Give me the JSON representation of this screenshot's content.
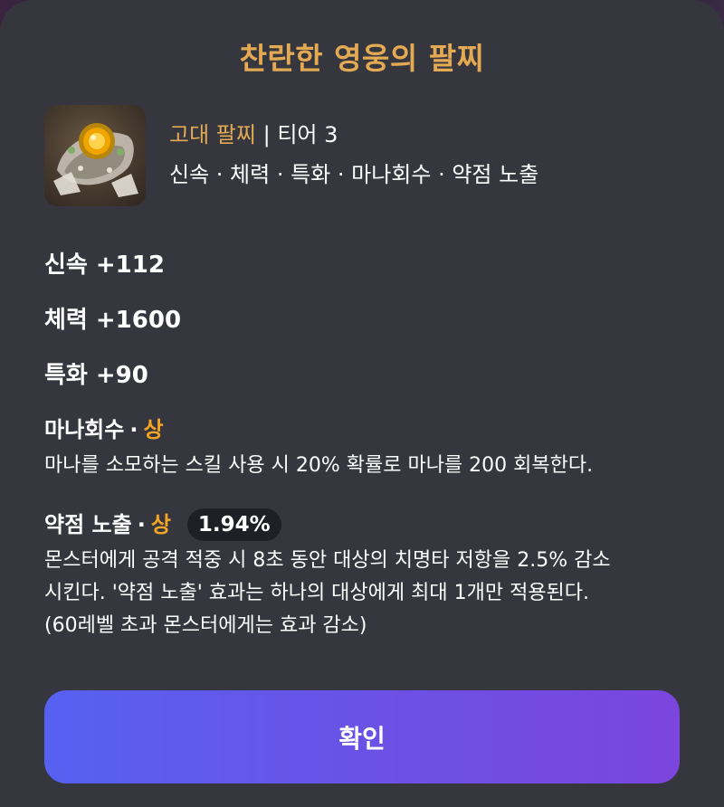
{
  "title": "찬란한 영웅의 팔찌",
  "item": {
    "icon": "bracelet-item-icon",
    "grade": "고대 팔찌",
    "separator": "|",
    "tier": "티어 3",
    "stats_summary": "신속 · 체력 · 특화 · 마나회수 · 약점 노출"
  },
  "stats": [
    {
      "label": "신속 +112"
    },
    {
      "label": "체력 +1600"
    },
    {
      "label": "특화 +90"
    }
  ],
  "effects": [
    {
      "name": "마나회수",
      "dot": "·",
      "level": "상",
      "description": "마나를 소모하는 스킬 사용 시 20% 확률로 마나를 200 회복한다."
    },
    {
      "name": "약점 노출",
      "dot": "·",
      "level": "상",
      "percent": "1.94%",
      "description_lines": [
        "몬스터에게 공격 적중 시 8초 동안 대상의 치명타 저항을 2.5% 감소",
        "시킨다. '약점 노출' 효과는 하나의 대상에게 최대 1개만 적용된다.",
        "(60레벨 초과 몬스터에게는 효과 감소)"
      ]
    }
  ],
  "confirm_label": "확인",
  "colors": {
    "accent_gold": "#e3a953",
    "level_orange": "#f5a524",
    "modal_bg": "#36373e",
    "button_start": "#5661f0",
    "button_end": "#7b45de"
  }
}
